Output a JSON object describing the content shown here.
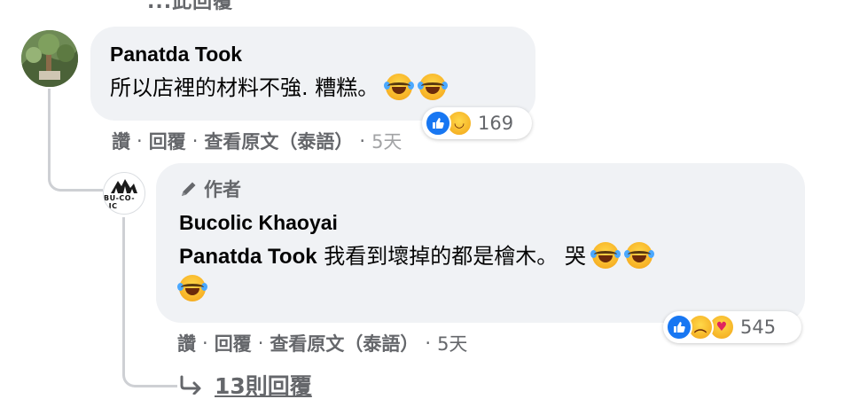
{
  "clipped_top_text": "...此回覆",
  "comment": {
    "author": "Panatda Took",
    "text": "所以店裡的材料不強. 糟糕。",
    "reactions": {
      "types": [
        "like-icon",
        "haha-icon"
      ],
      "count": "169"
    },
    "actions": {
      "like": "讚",
      "reply": "回覆",
      "see_original": "查看原文（泰語）",
      "time": "5天"
    }
  },
  "reply": {
    "author_badge": "作者",
    "avatar_text": "BU-CO-LIC",
    "author": "Bucolic Khaoyai",
    "mention": "Panatda Took",
    "text": " 我看到壞掉的都是檜木。 哭 ",
    "reactions": {
      "types": [
        "like-icon",
        "sad-icon",
        "care-icon"
      ],
      "count": "545"
    },
    "actions": {
      "like": "讚",
      "reply": "回覆",
      "see_original": "查看原文（泰語）",
      "time": "5天"
    }
  },
  "more_replies": {
    "label": "13則回覆"
  },
  "separator": "·"
}
